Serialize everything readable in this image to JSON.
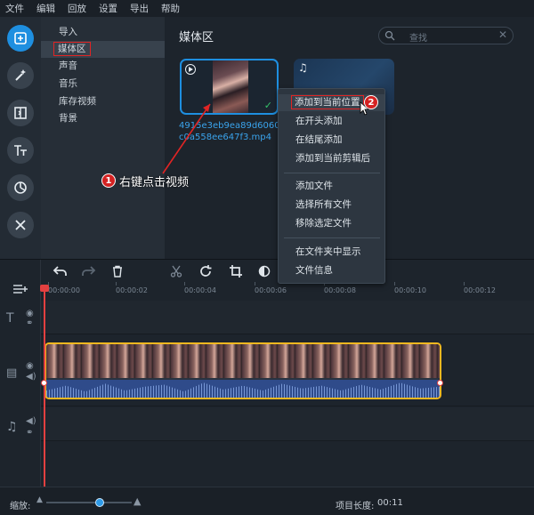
{
  "menubar": [
    "文件",
    "编辑",
    "回放",
    "设置",
    "导出",
    "帮助"
  ],
  "rail_icons": [
    "import-icon",
    "magic-wand-icon",
    "transitions-icon",
    "titles-icon",
    "stickers-icon",
    "tools-icon"
  ],
  "categories": [
    {
      "label": "导入",
      "selected": false,
      "highlighted": false
    },
    {
      "label": "媒体区",
      "selected": true,
      "highlighted": true
    },
    {
      "label": "声音",
      "selected": false,
      "highlighted": false
    },
    {
      "label": "音乐",
      "selected": false,
      "highlighted": false
    },
    {
      "label": "库存视频",
      "selected": false,
      "highlighted": false
    },
    {
      "label": "背景",
      "selected": false,
      "highlighted": false
    }
  ],
  "media": {
    "title": "媒体区",
    "search_placeholder": "查找",
    "file_name": "4915e3eb9ea89d6060bc0a558ee647f3.mp4"
  },
  "context_menu": {
    "items": [
      "添加到当前位置",
      "在开头添加",
      "在结尾添加",
      "添加到当前剪辑后",
      "添加文件",
      "选择所有文件",
      "移除选定文件",
      "在文件夹中显示",
      "文件信息"
    ],
    "highlighted_index": 0
  },
  "annotations": {
    "step1_number": "1",
    "step1_text": "右键点击视频",
    "step2_number": "2"
  },
  "ruler_ticks": [
    "00:00:00",
    "00:00:02",
    "00:00:04",
    "00:00:06",
    "00:00:08",
    "00:00:10",
    "00:00:12"
  ],
  "status": {
    "zoom_label": "缩放:",
    "zoom_level": 0.62,
    "project_length_label": "项目长度:",
    "project_length_value": "00:11"
  },
  "colors": {
    "accent": "#1e8fe0",
    "clip_border": "#f2b820",
    "annotation_red": "#e12424",
    "playhead": "#e34040"
  }
}
